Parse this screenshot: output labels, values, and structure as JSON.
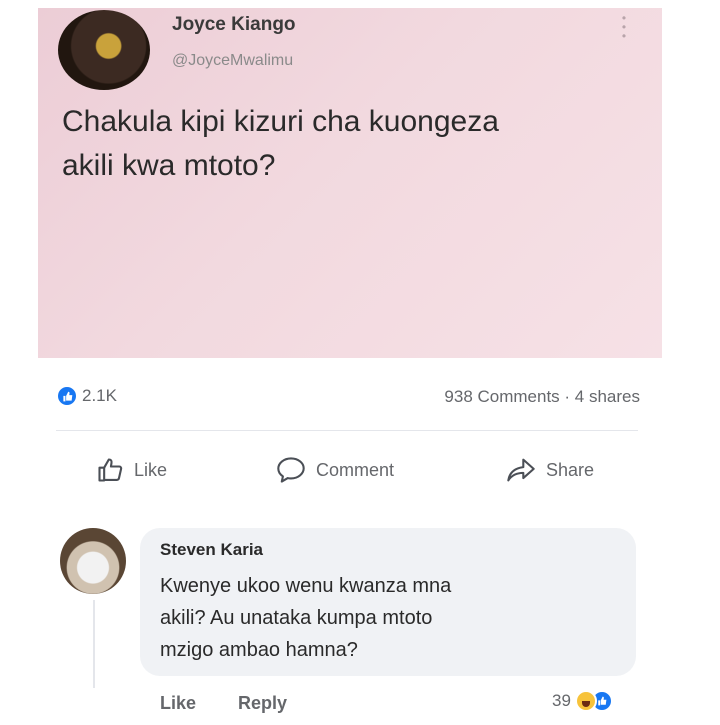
{
  "post": {
    "author_name": "Joyce Kiango",
    "author_handle": "@JoyceMwalimu",
    "text_line1": "Chakula kipi kizuri cha kuongeza",
    "text_line2": "akili kwa mtoto?",
    "background_color": "#f2d9df"
  },
  "stats": {
    "reaction_count": "2.1K",
    "comments_shares": "938 Comments · 4 shares"
  },
  "actions": {
    "like_label": "Like",
    "comment_label": "Comment",
    "share_label": "Share"
  },
  "comment": {
    "author_name": "Steven Karia",
    "text_line1": "Kwenye ukoo wenu kwanza mna",
    "text_line2": "akili? Au unataka kumpa mtoto",
    "text_line3": "mzigo ambao hamna?",
    "like_label": "Like",
    "reply_label": "Reply",
    "reaction_count": "39",
    "reactions": [
      "haha-icon",
      "like-icon"
    ]
  },
  "colors": {
    "accent": "#1877f2",
    "muted_text": "#65676b",
    "bubble": "#f0f2f5"
  }
}
